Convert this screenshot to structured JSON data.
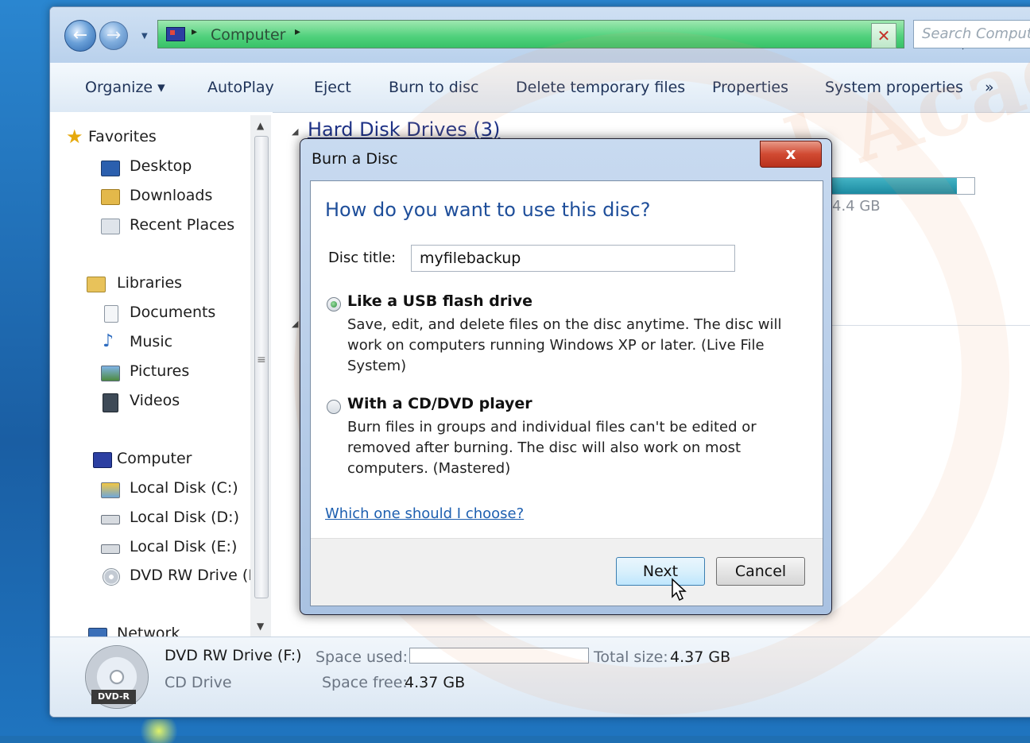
{
  "explorer": {
    "address": {
      "location": "Computer"
    },
    "search": {
      "placeholder": "Search Computer"
    },
    "toolbar": [
      "Organize ▾",
      "AutoPlay",
      "Eject",
      "Burn to disc",
      "Delete temporary files",
      "Properties",
      "System properties",
      "»"
    ],
    "nav": {
      "favorites": "Favorites",
      "favorites_items": [
        "Desktop",
        "Downloads",
        "Recent Places"
      ],
      "libraries": "Libraries",
      "libraries_items": [
        "Documents",
        "Music",
        "Pictures",
        "Videos"
      ],
      "computer": "Computer",
      "computer_items": [
        "Local Disk (C:)",
        "Local Disk (D:)",
        "Local Disk (E:)",
        "DVD RW Drive (F:"
      ],
      "network": "Network"
    },
    "content": {
      "hard_disk_group": "Hard Disk Drives (3)",
      "drive_free_fragment": "4.4 GB",
      "drive_used_fraction": 0.88
    },
    "details": {
      "disc_label": "DVD-R",
      "drive_name": "DVD RW Drive (F:)",
      "drive_type": "CD Drive",
      "space_used_label": "Space used:",
      "space_free_label": "Space free:",
      "space_free_value": "4.37 GB",
      "total_size_label": "Total size:",
      "total_size_value": "4.37 GB",
      "space_used_fraction": 0
    }
  },
  "dialog": {
    "title": "Burn a Disc",
    "close": "x",
    "heading": "How do you want to use this disc?",
    "disc_title_label": "Disc title:",
    "disc_title_value": "myfilebackup",
    "option1": {
      "title": "Like a USB flash drive",
      "desc": "Save, edit, and delete files on the disc anytime. The disc will work on computers running Windows XP or later. (Live File System)",
      "selected": true
    },
    "option2": {
      "title": "With a CD/DVD player",
      "desc": "Burn files in groups and individual files can't be edited or removed after burning. The disc will also work on most computers. (Mastered)",
      "selected": false
    },
    "help_link": "Which one should I choose?",
    "next_button": "Next",
    "cancel_button": "Cancel"
  },
  "watermark": {
    "text": "Unlimited Academy"
  },
  "colors": {
    "address_bar": "#4fd07b",
    "heading_blue": "#1e4e9a",
    "link_blue": "#1d5fb0",
    "close_red": "#d14a32"
  }
}
